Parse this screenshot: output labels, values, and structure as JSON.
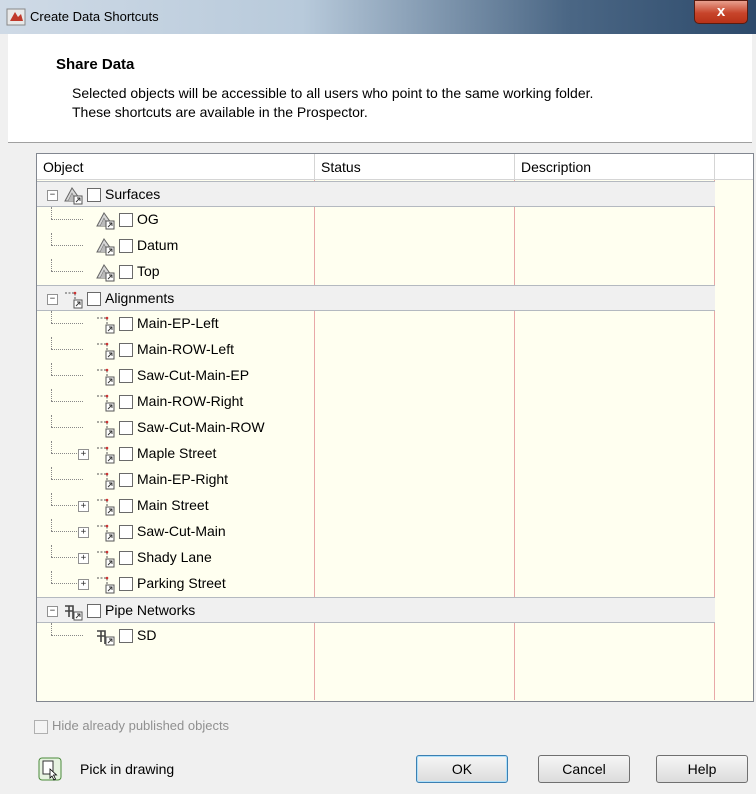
{
  "window": {
    "title": "Create Data Shortcuts",
    "close_label": "x"
  },
  "header": {
    "title": "Share Data",
    "description_line1": "Selected objects will be accessible to all users who point to the same working folder.",
    "description_line2": "These shortcuts are available in the Prospector."
  },
  "table": {
    "columns": [
      "Object",
      "Status",
      "Description"
    ],
    "rows": [
      {
        "label": "Surfaces",
        "level": 0,
        "expander": "−",
        "icon": "surface-icon"
      },
      {
        "label": "OG",
        "level": 1,
        "expander": "",
        "icon": "surface-icon"
      },
      {
        "label": "Datum",
        "level": 1,
        "expander": "",
        "icon": "surface-icon"
      },
      {
        "label": "Top",
        "level": 1,
        "expander": "",
        "icon": "surface-icon"
      },
      {
        "label": "Alignments",
        "level": 0,
        "expander": "−",
        "icon": "alignment-icon"
      },
      {
        "label": "Main-EP-Left",
        "level": 1,
        "expander": "",
        "icon": "alignment-icon"
      },
      {
        "label": "Main-ROW-Left",
        "level": 1,
        "expander": "",
        "icon": "alignment-icon"
      },
      {
        "label": "Saw-Cut-Main-EP",
        "level": 1,
        "expander": "",
        "icon": "alignment-icon"
      },
      {
        "label": "Main-ROW-Right",
        "level": 1,
        "expander": "",
        "icon": "alignment-icon"
      },
      {
        "label": "Saw-Cut-Main-ROW",
        "level": 1,
        "expander": "",
        "icon": "alignment-icon"
      },
      {
        "label": "Maple Street",
        "level": 1,
        "expander": "+",
        "icon": "alignment-icon"
      },
      {
        "label": "Main-EP-Right",
        "level": 1,
        "expander": "",
        "icon": "alignment-icon"
      },
      {
        "label": "Main Street",
        "level": 1,
        "expander": "+",
        "icon": "alignment-icon"
      },
      {
        "label": "Saw-Cut-Main",
        "level": 1,
        "expander": "+",
        "icon": "alignment-icon"
      },
      {
        "label": "Shady Lane",
        "level": 1,
        "expander": "+",
        "icon": "alignment-icon"
      },
      {
        "label": "Parking Street",
        "level": 1,
        "expander": "+",
        "icon": "alignment-icon"
      },
      {
        "label": "Pipe Networks",
        "level": 0,
        "expander": "−",
        "icon": "pipe-network-icon"
      },
      {
        "label": "SD",
        "level": 1,
        "expander": "",
        "icon": "pipe-network-icon"
      }
    ]
  },
  "footer": {
    "hide_published_label": "Hide already published objects",
    "pick_label": "Pick in drawing",
    "ok_label": "OK",
    "cancel_label": "Cancel",
    "help_label": "Help"
  }
}
